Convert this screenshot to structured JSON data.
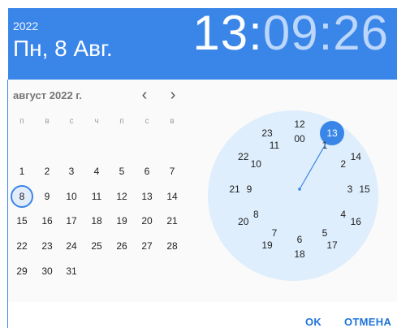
{
  "header": {
    "year": "2022",
    "date": "Пн, 8 Авг.",
    "time_hh": "13",
    "time_sep1": ":",
    "time_mm": "09",
    "time_sep2": ":",
    "time_ss": "26"
  },
  "calendar": {
    "month_label": "август 2022 г.",
    "prev": "‹",
    "next": "›",
    "weekdays": [
      "п",
      "в",
      "с",
      "ч",
      "п",
      "с",
      "в"
    ],
    "weeks": [
      [
        "1",
        "2",
        "3",
        "4",
        "5",
        "6",
        "7"
      ],
      [
        "8",
        "9",
        "10",
        "11",
        "12",
        "13",
        "14"
      ],
      [
        "15",
        "16",
        "17",
        "18",
        "19",
        "20",
        "21"
      ],
      [
        "22",
        "23",
        "24",
        "25",
        "26",
        "27",
        "28"
      ],
      [
        "29",
        "30",
        "31",
        "",
        "",
        "",
        ""
      ]
    ],
    "selected_day": "8"
  },
  "clock": {
    "inner": [
      "00",
      "1",
      "2",
      "3",
      "4",
      "5",
      "6",
      "7",
      "8",
      "9",
      "10",
      "11"
    ],
    "outer": [
      "12",
      "13",
      "14",
      "15",
      "16",
      "17",
      "18",
      "19",
      "20",
      "21",
      "22",
      "23"
    ],
    "selected": "13"
  },
  "buttons": {
    "ok": "OK",
    "cancel": "ОТМЕНА"
  },
  "colors": {
    "accent": "#3a86e8",
    "dial": "#dfeefc"
  }
}
